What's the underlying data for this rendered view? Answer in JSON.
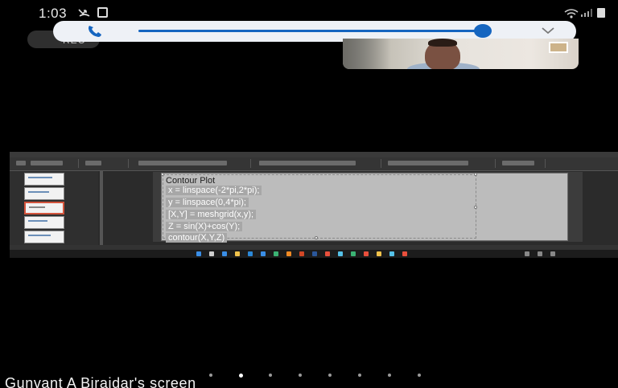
{
  "status_bar": {
    "time": "1:03",
    "icons": [
      "missed-call-icon",
      "picture-icon",
      "wifi-icon",
      "signal-icon",
      "battery-icon"
    ]
  },
  "call_controls": {
    "rec_label": "REC",
    "accent_color": "#1565c0",
    "seek_progress": 0.95,
    "icons": [
      "phone-icon",
      "chevron-down-icon"
    ]
  },
  "shared_screen": {
    "slide": {
      "title": "Contour Plot",
      "code_lines": [
        "x = linspace(-2*pi,2*pi);",
        "y = linspace(0,4*pi);",
        "[X,Y] = meshgrid(x,y);",
        "Z = sin(X)+cos(Y);",
        "contour(X,Y,Z)"
      ]
    }
  },
  "pager": {
    "dot_count": 8,
    "active_index": 1
  },
  "caption": "Gunvant A Birajdar's screen"
}
